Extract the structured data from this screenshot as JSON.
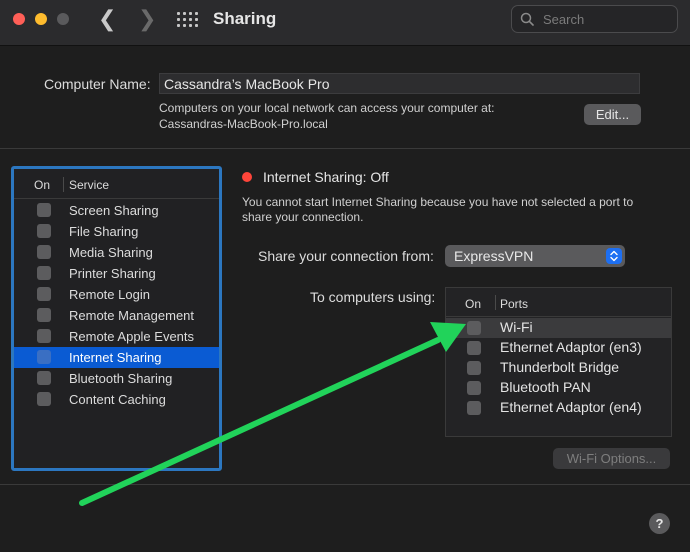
{
  "window": {
    "title": "Sharing",
    "back_glyph": "❮",
    "forward_glyph": "❯",
    "search_placeholder": "Search"
  },
  "computer": {
    "name_label": "Computer Name:",
    "name_value": "Cassandra’s MacBook Pro",
    "desc_line1": "Computers on your local network can access your computer at:",
    "desc_line2": "Cassandras-MacBook-Pro.local",
    "edit_label": "Edit..."
  },
  "services": {
    "header_on": "On",
    "header_service": "Service",
    "selected_index": 7,
    "items": [
      {
        "label": "Screen Sharing",
        "checked": false
      },
      {
        "label": "File Sharing",
        "checked": false
      },
      {
        "label": "Media Sharing",
        "checked": false
      },
      {
        "label": "Printer Sharing",
        "checked": false
      },
      {
        "label": "Remote Login",
        "checked": false
      },
      {
        "label": "Remote Management",
        "checked": false
      },
      {
        "label": "Remote Apple Events",
        "checked": false
      },
      {
        "label": "Internet Sharing",
        "checked": false
      },
      {
        "label": "Bluetooth Sharing",
        "checked": false
      },
      {
        "label": "Content Caching",
        "checked": false
      }
    ]
  },
  "detail": {
    "status_text": "Internet Sharing: Off",
    "status_color": "#ff453a",
    "desc_line1": "You cannot start Internet Sharing because you have not selected a port to",
    "desc_line2": "share your connection.",
    "share_from_label": "Share your connection from:",
    "share_from_value": "ExpressVPN",
    "to_computers_label": "To computers using:",
    "ports_header_on": "On",
    "ports_header_ports": "Ports",
    "ports": [
      {
        "label": "Wi-Fi",
        "checked": false,
        "highlighted": true
      },
      {
        "label": "Ethernet Adaptor (en3)",
        "checked": false,
        "highlighted": false
      },
      {
        "label": "Thunderbolt Bridge",
        "checked": false,
        "highlighted": false
      },
      {
        "label": "Bluetooth PAN",
        "checked": false,
        "highlighted": false
      },
      {
        "label": "Ethernet Adaptor (en4)",
        "checked": false,
        "highlighted": false
      }
    ],
    "wifi_options_label": "Wi-Fi Options...",
    "help_label": "?"
  },
  "annotation": {
    "arrow_color": "#21d35a",
    "points_to": "Wi-Fi checkbox"
  },
  "colors": {
    "accent": "#0a5bd3",
    "focus_ring": "#2c77c0"
  }
}
